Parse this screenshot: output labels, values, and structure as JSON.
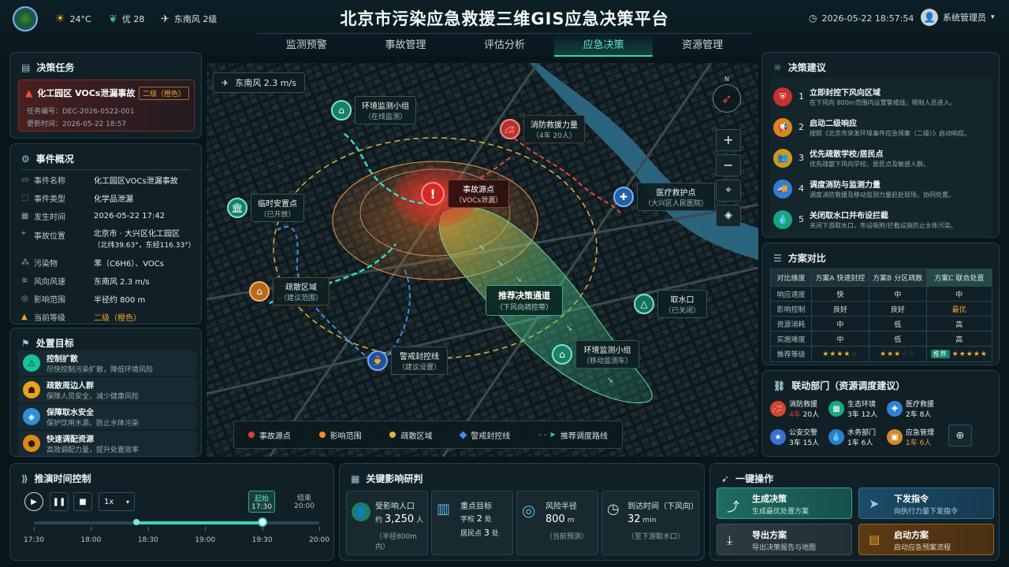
{
  "header": {
    "title": "北京市污染应急救援三维GIS应急决策平台",
    "weather": {
      "temp": "24°C",
      "aqi": "优 28",
      "wind": "东南风 2级"
    },
    "datetime": "2026-05-22 18:57:54",
    "user": "系统管理员",
    "accent": "#35d6b4"
  },
  "nav": {
    "items": [
      "监测预警",
      "事故管理",
      "评估分析",
      "应急决策",
      "资源管理"
    ],
    "active": "应急决策"
  },
  "task": {
    "title": "决策任务",
    "event": "化工园区 VOCs泄漏事故",
    "level_badge": "二级（橙色）",
    "id_line": "任务编号：DEC-2026-0522-001",
    "update_line": "更新时间：2026-05-22 18:57"
  },
  "overview": {
    "title": "事件概况",
    "rows": [
      {
        "label": "事件名称",
        "value": "化工园区VOCs泄漏事故",
        "icon": "doc"
      },
      {
        "label": "事件类型",
        "value": "化学品泄漏",
        "icon": "tag"
      },
      {
        "label": "发生时间",
        "value": "2026-05-22 17:42",
        "icon": "calendar"
      },
      {
        "label": "事故位置",
        "value": "北京市 · 大兴区化工园区",
        "value2": "（北纬39.63°，东经116.33°）",
        "icon": "pin"
      },
      {
        "label": "污染物",
        "value": "苯（C6H6）、VOCs",
        "icon": "molecule"
      },
      {
        "label": "风向风速",
        "value": "东南风  2.3 m/s",
        "icon": "wind"
      },
      {
        "label": "影响范围",
        "value": "半径约 800 m",
        "icon": "target"
      },
      {
        "label": "当前等级",
        "value": "二级（橙色）",
        "icon": "warning"
      }
    ]
  },
  "goals": {
    "title": "处置目标",
    "items": [
      {
        "title": "控制扩散",
        "desc": "尽快控制污染扩散，降低环境风险",
        "color": "#18c49a",
        "icon": "⚠"
      },
      {
        "title": "疏散周边人群",
        "desc": "保障人员安全，减少健康风险",
        "color": "#e8a21d",
        "icon": "☗"
      },
      {
        "title": "保障取水安全",
        "desc": "保护饮用水源，防止水体污染",
        "color": "#2f8fd8",
        "icon": "◈"
      },
      {
        "title": "快速调配资源",
        "desc": "高效调配力量，提升处置效率",
        "color": "#d98a18",
        "icon": "⬢"
      }
    ]
  },
  "map": {
    "wind_label": "东南风  2.3 m/s",
    "compass": "N",
    "markers": [
      {
        "id": "env1",
        "title": "环境监测小组",
        "sub": "（在线监测）"
      },
      {
        "id": "fire",
        "title": "消防救援力量",
        "sub": "（4车 20人）"
      },
      {
        "id": "source",
        "title": "事故源点",
        "sub": "（VOCs泄漏）"
      },
      {
        "id": "medical",
        "title": "医疗救护点",
        "sub": "（大兴区人民医院）"
      },
      {
        "id": "shelter",
        "title": "临时安置点",
        "sub": "（已开放）"
      },
      {
        "id": "evac",
        "title": "疏散区域",
        "sub": "（建议范围）"
      },
      {
        "id": "channel",
        "title": "推荐决策通道",
        "sub": "（下风向疏控带）"
      },
      {
        "id": "water",
        "title": "取水口",
        "sub": "（已关闭）"
      },
      {
        "id": "police",
        "title": "警戒封控线",
        "sub": "（建议设置）"
      },
      {
        "id": "env2",
        "title": "环境监测小组",
        "sub": "（移动监测车）"
      }
    ],
    "legend": [
      {
        "label": "事故源点",
        "color": "#e23b3b"
      },
      {
        "label": "影响范围",
        "color": "#ef8a2e"
      },
      {
        "label": "疏散区域",
        "color": "#e4b23a"
      },
      {
        "label": "警戒封控线",
        "color": "#3f8ee8"
      },
      {
        "label": "推荐调度路线",
        "color": "#35d6c4"
      }
    ]
  },
  "suggest": {
    "title": "决策建议",
    "items": [
      {
        "num": "1",
        "title": "立即封控下风向区域",
        "desc": "在下风向 800m范围内设置警戒线，限制人员进入。",
        "color": "#c43232"
      },
      {
        "num": "2",
        "title": "启动二级响应",
        "desc": "按照《北京市突发环境事件应急预案（二级）》启动响应。",
        "color": "#d9861b"
      },
      {
        "num": "3",
        "title": "优先疏散学校/居民点",
        "desc": "优先疏散下风向学校、居民点及敏感人群。",
        "color": "#cf9a1c"
      },
      {
        "num": "4",
        "title": "调度消防与监测力量",
        "desc": "调度消防救援及移动监测力量赶赴现场，协同处置。",
        "color": "#2f7fd6"
      },
      {
        "num": "5",
        "title": "关闭取水口并布设拦截",
        "desc": "关闭下游取水口，布设吸附/拦截设施防止水体污染。",
        "color": "#1ba37c"
      }
    ]
  },
  "compare": {
    "title": "方案对比",
    "headers": [
      "对比维度",
      "方案A 快速封控",
      "方案B 分区疏散",
      "方案C 联合处置"
    ],
    "rows": [
      [
        "响应速度",
        "快",
        "中",
        "中"
      ],
      [
        "影响控制",
        "良好",
        "良好",
        "最优"
      ],
      [
        "资源消耗",
        "中",
        "低",
        "高"
      ],
      [
        "实施难度",
        "中",
        "低",
        "高"
      ]
    ],
    "rating_label": "推荐等级",
    "ratings": [
      4,
      3,
      5
    ],
    "recommend": "推荐"
  },
  "depts": {
    "title": "联动部门（资源调度建议）",
    "items": [
      {
        "name": "消防救援",
        "pre": "4车",
        "num": "20",
        "unit": "人",
        "color": "#d6452f",
        "icon": "🚒"
      },
      {
        "name": "生态环境",
        "pre": "3车",
        "num": "12",
        "unit": "人",
        "color": "#19a884",
        "icon": "▦"
      },
      {
        "name": "医疗救援",
        "pre": "2车",
        "num": "8",
        "unit": "人",
        "color": "#2f82d6",
        "icon": "✚"
      },
      {
        "name": "公安交警",
        "pre": "3车",
        "num": "15",
        "unit": "人",
        "color": "#3a6fd0",
        "icon": "★"
      },
      {
        "name": "水务部门",
        "pre": "1车",
        "num": "6",
        "unit": "人",
        "color": "#2a7fcc",
        "icon": "💧"
      },
      {
        "name": "应急管理",
        "pre": "1车",
        "num": "6",
        "unit": "人",
        "color": "#d3892a",
        "icon": "▣"
      }
    ]
  },
  "timeline": {
    "title": "推演时间控制",
    "speed": "1x",
    "start_label": "起始",
    "start_time": "17:30",
    "end_label": "结束",
    "end_time": "20:00",
    "ticks": [
      "17:30",
      "18:00",
      "18:30",
      "19:00",
      "19:30",
      "20:00"
    ],
    "progress_from": 0.36,
    "progress_to": 0.8
  },
  "impact": {
    "title": "关键影响研判",
    "cards": [
      {
        "label": "受影响人口",
        "prefix": "约",
        "value": "3,250",
        "unit": "人",
        "sub": "（半径800m内）",
        "icon": "people"
      },
      {
        "label": "重点目标",
        "line1a": "学校",
        "line1b": "2",
        "line1c": "处",
        "line2a": "居民点",
        "line2b": "3",
        "line2c": "处",
        "icon": "building"
      },
      {
        "label": "风险半径",
        "value": "800",
        "unit": "m",
        "sub": "（当前预测）",
        "icon": "radar"
      },
      {
        "label": "到达时间（下风向）",
        "value": "32",
        "unit": "min",
        "sub": "（至下游取水口）",
        "icon": "clock"
      }
    ]
  },
  "actions": {
    "title": "一键操作",
    "items": [
      {
        "title": "生成决策",
        "desc": "生成最优处置方案",
        "color": "#1f6b63"
      },
      {
        "title": "下发指令",
        "desc": "向执行力量下发指令",
        "color": "#1c4a66"
      },
      {
        "title": "导出方案",
        "desc": "导出决策报告与地图",
        "color": "#2a3a40"
      },
      {
        "title": "启动方案",
        "desc": "启动应急预案流程",
        "color": "#5a3a14"
      }
    ]
  }
}
